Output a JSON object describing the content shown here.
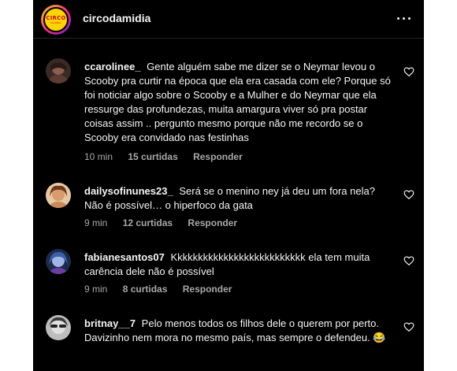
{
  "header": {
    "account": "circodamidia",
    "logo_word": "CIRCO",
    "logo_sub": "DA MÍDIA"
  },
  "comments": [
    {
      "username": "ccarolinee_",
      "text": "Gente alguém sabe me dizer se o Neymar levou o Scooby pra curtir na época que ela era casada com ele? Porque só foi noticiar algo sobre o Scooby e a Mulher e do Neymar que ela ressurge das profundezas, muita amargura viver só pra postar coisas assim .. pergunto mesmo porque não me recordo se o Scooby era convidado nas festinhas",
      "time": "10 min",
      "likes": "15 curtidas",
      "reply": "Responder",
      "avatar_color": "#6b4a3f"
    },
    {
      "username": "dailysofinunes23_",
      "text": "Será se o menino ney já deu um fora nela? Não é possível… o hiperfoco da gata",
      "time": "9 min",
      "likes": "12 curtidas",
      "reply": "Responder",
      "avatar_color": "#c98a5a"
    },
    {
      "username": "fabianesantos07",
      "text": "Kkkkkkkkkkkkkkkkkkkkkkkkkk ela tem muita carência dele não é possível",
      "time": "9 min",
      "likes": "8 curtidas",
      "reply": "Responder",
      "avatar_color": "#5a7fc4"
    },
    {
      "username": "britnay__7",
      "text": "Pelo menos todos os filhos dele o querem por perto. Davizinho nem mora no mesmo país, mas sempre o defendeu. 😂",
      "time": "",
      "likes": "",
      "reply": "",
      "avatar_color": "#8a8a8a"
    }
  ],
  "colors": {
    "background": "#000000",
    "text": "#f5f5f5",
    "muted": "#a8a8a8",
    "frame": "#ffffff"
  }
}
